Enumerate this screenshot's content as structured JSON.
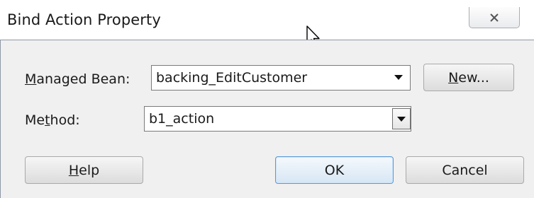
{
  "dialog": {
    "title": "Bind Action Property"
  },
  "form": {
    "managed_bean": {
      "label_mnemonic": "M",
      "label_rest": "anaged Bean:",
      "value": "backing_EditCustomer"
    },
    "method": {
      "label_before": "Me",
      "label_mnemonic": "t",
      "label_after": "hod:",
      "value": "b1_action"
    }
  },
  "buttons": {
    "new": {
      "mnemonic": "N",
      "rest": "ew..."
    },
    "help": {
      "mnemonic": "H",
      "rest": "elp"
    },
    "ok": "OK",
    "cancel": "Cancel"
  },
  "icons": {
    "close": "close-icon",
    "cursor": "mouse-pointer-icon",
    "dropdown": "dropdown-arrow-icon"
  },
  "colors": {
    "dialog_bg": "#f0f0f0",
    "default_button_border": "#5a9ad6"
  }
}
